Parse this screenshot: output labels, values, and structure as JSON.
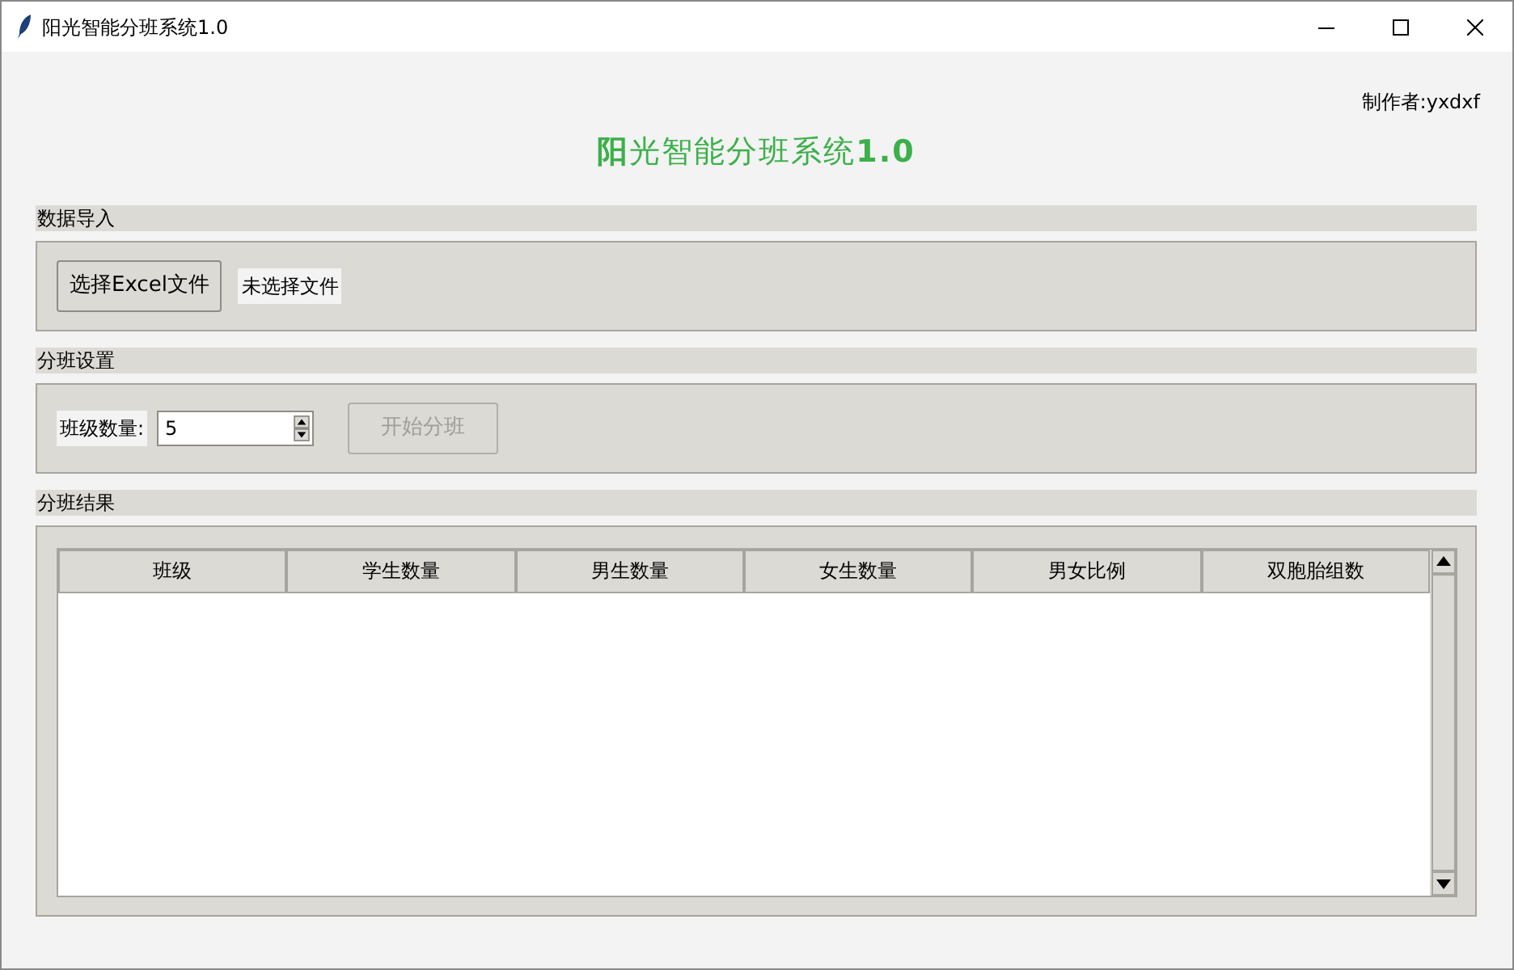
{
  "window": {
    "title": "阳光智能分班系统1.0"
  },
  "author": "制作者:yxdxf",
  "heading": "**阳**光智能分班系统**1.0**",
  "import_section": {
    "title": "数据导入",
    "button": "选择Excel文件",
    "file_status": "未选择文件"
  },
  "settings_section": {
    "title": "分班设置",
    "label": "班级数量:",
    "value": "5",
    "start_button": {
      "label": "开始分班",
      "disabled": true
    }
  },
  "result_section": {
    "title": "分班结果",
    "table": {
      "columns": [
        "班级",
        "学生数量",
        "男生数量",
        "女生数量",
        "男女比例",
        "双胞胎组数"
      ]
    }
  }
}
